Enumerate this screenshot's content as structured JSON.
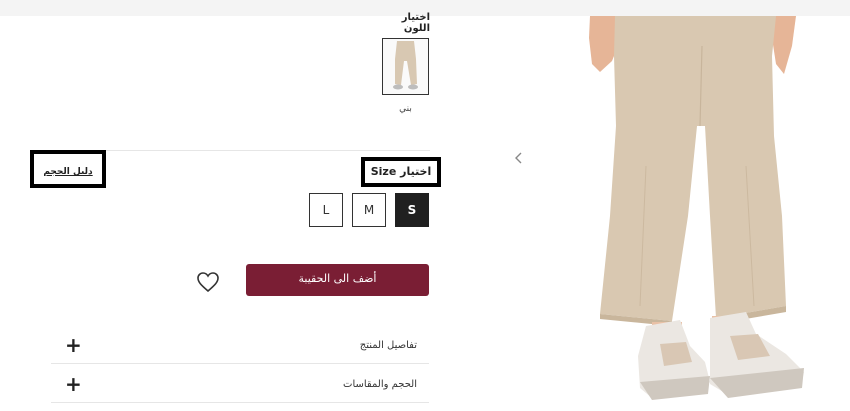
{
  "color": {
    "title": "اختيار اللون",
    "selected_name": "بني",
    "swatch_color": "#d8c8b2"
  },
  "size": {
    "title": "اختيار Size",
    "guide_label": "دليل الحجم",
    "options": [
      "S",
      "M",
      "L"
    ],
    "selected": "S"
  },
  "actions": {
    "add_to_bag": "أضف الى الحقيبة",
    "wishlist_icon": "heart-outline-icon"
  },
  "accordion": [
    {
      "label": "تفاصيل المنتج",
      "icon": "plus-icon",
      "expanded": false
    },
    {
      "label": "الحجم والمقاسات",
      "icon": "plus-icon",
      "expanded": false
    }
  ],
  "colors": {
    "accent": "#7a1e34",
    "selected_size": "#202020",
    "trousers": "#d9c8b1",
    "skin": "#e6b597"
  }
}
